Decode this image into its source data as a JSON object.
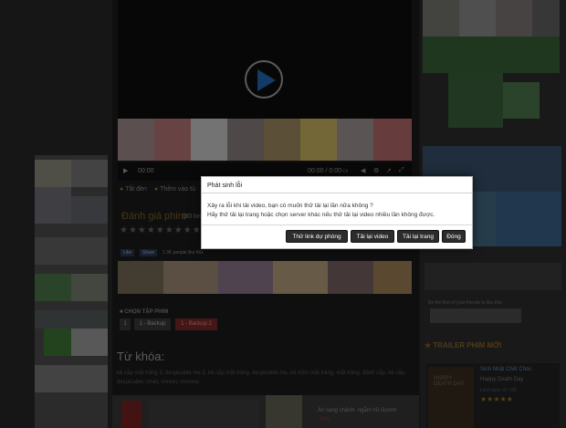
{
  "player": {
    "time_current": "00:00",
    "time_total": "00:00 / 0:00",
    "lights_off": "Tắt đèn",
    "add_to": "Thêm vào tủ"
  },
  "rating": {
    "title": "Đánh giá phim",
    "count": "(80 lượt)",
    "stars": "★★★★★★★★★★"
  },
  "social": {
    "like": "Like",
    "share": "Share",
    "people": "1.3K people like this"
  },
  "episodes": {
    "title": "CHỌN TẬP PHIM",
    "items": [
      "1",
      "1 - Backup",
      "1 - Backup 2"
    ]
  },
  "keywords": {
    "title": "Từ khóa:",
    "text": "kẻ cắp mặt trăng 3, despicable me 3, kẻ cắp mặt trăng, despicable me, kẻ trộm mặt trăng, mặt trăng, đánh cắp, kẻ cắp, despicable, ninet, minion, minions"
  },
  "ad": {
    "title": "Ăn sang chảnh- ngắm hồ Gươm",
    "discount": "-20%"
  },
  "right": {
    "friends_text": "Be the first of your friends to like this",
    "trailer_title": "TRAILER PHIM MỚI",
    "movie_title": "Sinh Nhật Chết Chóc",
    "movie_sub": "Happy Death Day",
    "views": "Lượt xem: 47.725",
    "stars": "★★★★★",
    "poster_text": "HAPPY DEATH DAY"
  },
  "modal": {
    "title": "Phát sinh lỗi",
    "line1": "Xảy ra lỗi khi tải video, bạn có muốn thử tải lại lần nữa không ?",
    "line2": "Hãy thử tải lại trang hoặc chọn server khác nếu thử tải lại video nhiều lần không được.",
    "btn_backup": "Thử link dự phòng",
    "btn_reload_video": "Tải lại video",
    "btn_reload_page": "Tải lại trang",
    "btn_close": "Đóng"
  }
}
